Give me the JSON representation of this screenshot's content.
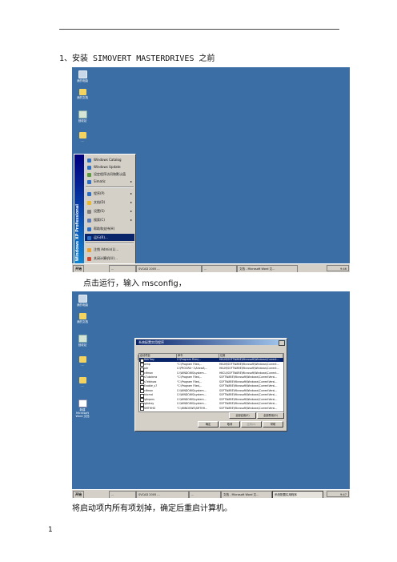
{
  "doc": {
    "heading_1": "1、安装 SIMOVERT MASTERDRIVES 之前",
    "caption_1": "点击运行，输入 msconfig，",
    "caption_2": "将启动项内所有项划掉，确定后重启计算机。",
    "page_number": "1"
  },
  "shot1": {
    "desktop_icons": [
      {
        "label": "我的电脑",
        "icon": "computer-icon"
      },
      {
        "label": "我的文档",
        "icon": "folder-icon"
      },
      {
        "label": "回收站",
        "icon": "recycle-bin-icon"
      },
      {
        "label": "...",
        "icon": "folder-icon"
      }
    ],
    "start_menu": {
      "side_label": "Windows XP Professional",
      "items": [
        {
          "label": "Windows Catalog",
          "color": "#2d6fc4"
        },
        {
          "label": "Windows Update",
          "color": "#2d6fc4"
        },
        {
          "label": "设定程序访问和默认值",
          "color": "#5a9a3c"
        },
        {
          "label": "Simatic",
          "color": "#2d6fc4",
          "submenu": true
        },
        {
          "label": "程序(P)",
          "color": "#2d6fc4",
          "submenu": true
        },
        {
          "label": "文档(D)",
          "color": "#e8b830",
          "submenu": true
        },
        {
          "label": "设置(S)",
          "color": "#808080",
          "submenu": true
        },
        {
          "label": "搜索(C)",
          "color": "#5a7ab8",
          "submenu": true
        },
        {
          "label": "帮助和支持(H)",
          "color": "#2d6fc4"
        },
        {
          "label": "运行(R)...",
          "color": "#2d6fc4",
          "selected": true
        },
        {
          "label": "注销 Admin(L)...",
          "color": "#e8a030"
        },
        {
          "label": "关闭计算机(U)...",
          "color": "#d04a30"
        }
      ]
    },
    "taskbar": {
      "start_label": "开始",
      "buttons": [
        "...",
        "SVCAD 2005 ...",
        "...",
        "文档 - Microsoft Word 文..."
      ],
      "clock": "9:46"
    }
  },
  "shot2": {
    "desktop_icons": [
      {
        "label": "我的电脑",
        "icon": "computer-icon"
      },
      {
        "label": "我的文档",
        "icon": "folder-icon"
      },
      {
        "label": "回收站",
        "icon": "recycle-bin-icon"
      },
      {
        "label": "...",
        "icon": "folder-icon"
      },
      {
        "label": "...",
        "icon": "folder-icon"
      },
      {
        "label": "新建 Microsoft Word 文档",
        "icon": "word-doc-icon"
      }
    ],
    "dialog": {
      "title": "系统配置实用程序",
      "tabs": [
        "一般",
        "SYSTEM.INI",
        "WIN.INI",
        "BOOT.INI",
        "服务",
        "启动"
      ],
      "columns": [
        "启动项目",
        "命令",
        "位置"
      ],
      "rows": [
        {
          "name": "RAVTray",
          "command": "C:\\Program Files\\...",
          "location": "HKLM\\SOFTWARE\\Microsoft\\Windows\\Current..."
        },
        {
          "name": "wmp",
          "command": "\"C:\\Program Files\\...",
          "location": "HKLM\\SOFTWARE\\Microsoft\\Windows\\Current..."
        },
        {
          "name": "pdr",
          "command": "C:\\PROGRA~1\\Ahead\\...",
          "location": "HKLM\\SOFTWARE\\Microsoft\\Windows\\Current..."
        },
        {
          "name": "ctfmon",
          "command": "C:\\WINDOWS\\system...",
          "location": "HKCU\\SOFTWARE\\Microsoft\\Windows\\Current..."
        },
        {
          "name": "s7ubckmx",
          "command": "\"C:\\Program Files\\...",
          "location": "SOFTWARE\\Microsoft\\Windows\\CurrentVersi..."
        },
        {
          "name": "s7ebtnwx",
          "command": "\"C:\\Program Files\\...",
          "location": "SOFTWARE\\Microsoft\\Windows\\CurrentVersi..."
        },
        {
          "name": "Enable_s7",
          "command": "\"C:\\Program Files\\...",
          "location": "SOFTWARE\\Microsoft\\Windows\\CurrentVersi..."
        },
        {
          "name": "ctfmon",
          "command": "C:\\WINDOWS\\system...",
          "location": "SOFTWARE\\Microsoft\\Windows\\CurrentVersi..."
        },
        {
          "name": "hkcmd",
          "command": "C:\\WINDOWS\\system...",
          "location": "SOFTWARE\\Microsoft\\Windows\\CurrentVersi..."
        },
        {
          "name": "igfxpers",
          "command": "C:\\WINDOWS\\system...",
          "location": "SOFTWARE\\Microsoft\\Windows\\CurrentVersi..."
        },
        {
          "name": "igfxtray",
          "command": "C:\\WINDOWS\\system...",
          "location": "SOFTWARE\\Microsoft\\Windows\\CurrentVersi..."
        },
        {
          "name": "SMTHHD",
          "command": "\"C:\\WINDOWS\\SMTHH...",
          "location": "SOFTWARE\\Microsoft\\Windows\\CurrentVersi..."
        }
      ],
      "btn_enable_all": "全部启用(E)",
      "btn_disable_all": "全部禁用(D)",
      "btn_ok": "确定",
      "btn_cancel": "取消",
      "btn_apply": "应用(A)",
      "btn_help": "帮助"
    },
    "taskbar": {
      "start_label": "开始",
      "buttons": [
        "...",
        "SVCAD 2005 ...",
        "...",
        "文档 - Microsoft Word 文...",
        "系统配置实用程序"
      ],
      "clock": "9:47"
    }
  }
}
